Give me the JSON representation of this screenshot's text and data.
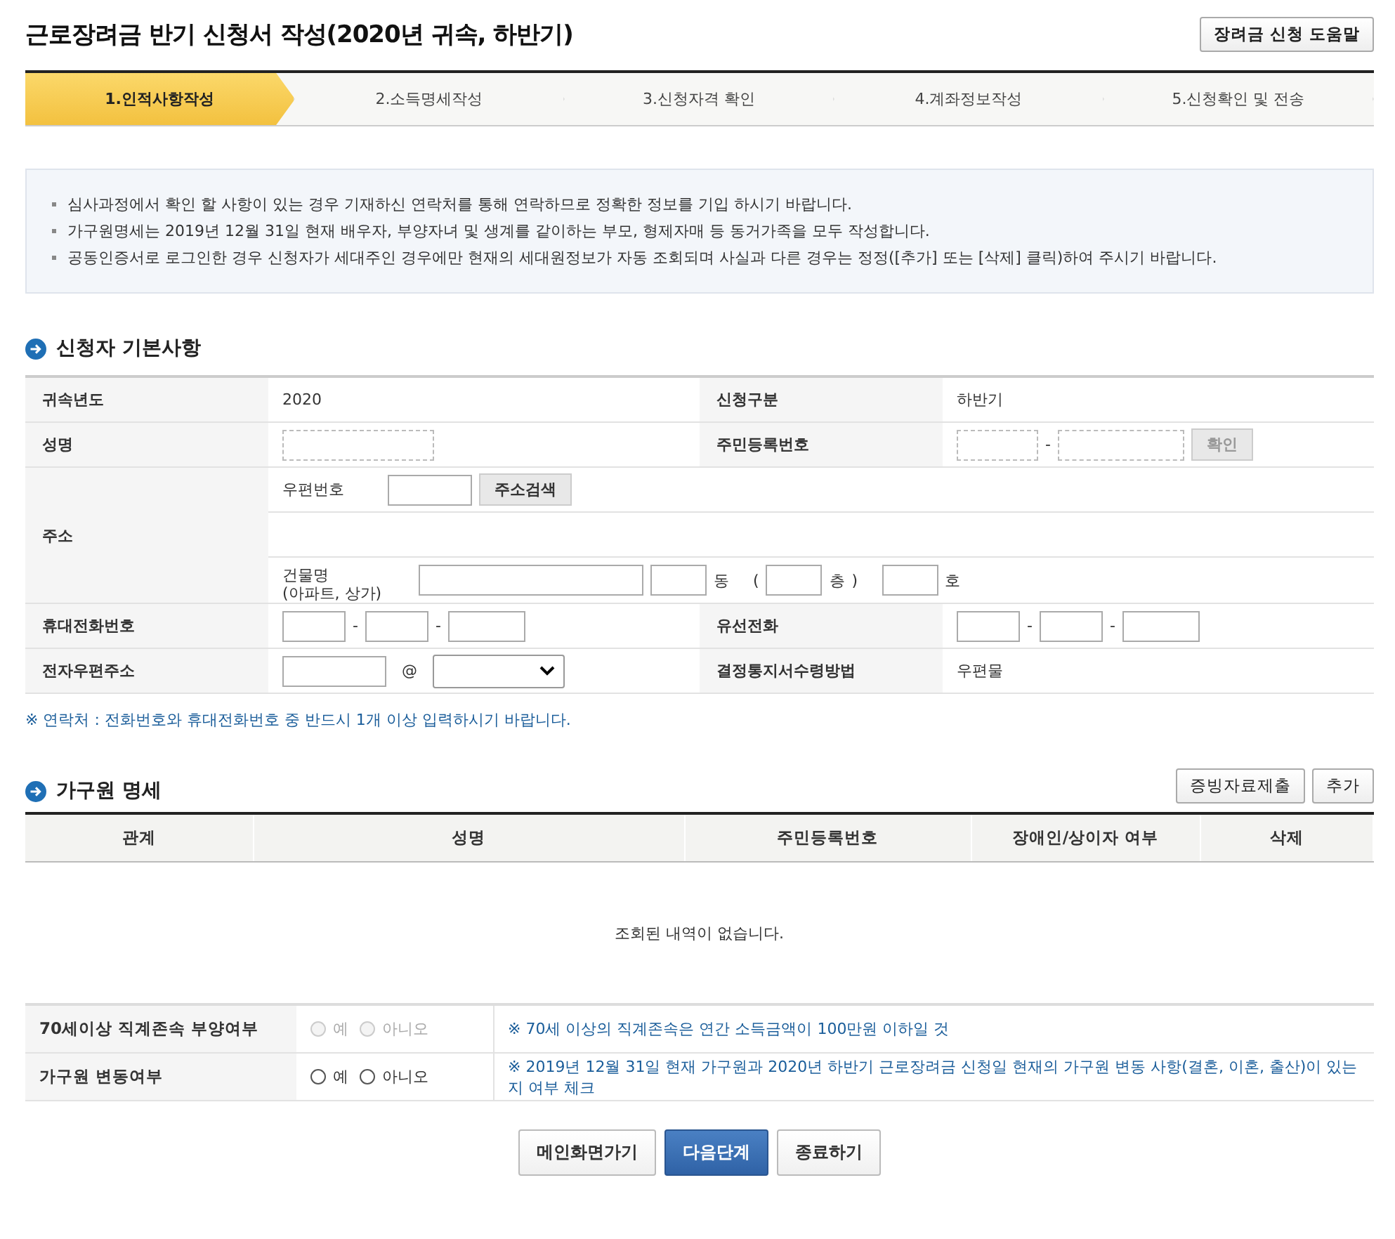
{
  "title": "근로장려금 반기 신청서 작성(2020년 귀속, 하반기)",
  "help_button": "장려금 신청 도움말",
  "steps": [
    {
      "label": "1.인적사항작성",
      "selected": true
    },
    {
      "label": "2.소득명세작성",
      "selected": false
    },
    {
      "label": "3.신청자격 확인",
      "selected": false
    },
    {
      "label": "4.계좌정보작성",
      "selected": false
    },
    {
      "label": "5.신청확인 및 전송",
      "selected": false
    }
  ],
  "notices": [
    "심사과정에서 확인 할 사항이 있는 경우 기재하신 연락처를 통해 연락하므로 정확한 정보를 기입 하시기 바랍니다.",
    "가구원명세는 2019년 12월 31일 현재 배우자, 부양자녀 및 생계를 같이하는 부모, 형제자매 등 동거가족을 모두 작성합니다.",
    "공동인증서로 로그인한 경우 신청자가 세대주인 경우에만 현재의 세대원정보가 자동 조회되며 사실과 다른 경우는 정정([추가] 또는 [삭제] 클릭)하여 주시기 바랍니다."
  ],
  "applicant": {
    "title": "신청자 기본사항",
    "year_label": "귀속년도",
    "year_value": "2020",
    "type_label": "신청구분",
    "type_value": "하반기",
    "name_label": "성명",
    "rrn_label": "주민등록번호",
    "rrn_separator": "-",
    "confirm_button": {
      "label": "확인",
      "disabled": true
    },
    "address_label": "주소",
    "postcode_label": "우편번호",
    "search_button": "주소검색",
    "building_label": "건물명",
    "building_sub": "(아파트, 상가)",
    "dong": "동",
    "floor_open": "(",
    "floor": "층",
    "floor_close": ")",
    "ho": "호",
    "mobile_label": "휴대전화번호",
    "mobile_separators": [
      "-",
      "-"
    ],
    "phone_label": "유선전화",
    "phone_separators": [
      "-",
      "-"
    ],
    "email_label": "전자우편주소",
    "at": "@",
    "method_label": "결정통지서수령방법",
    "method_value": "우편물"
  },
  "contact_note": "※ 연락처 : 전화번호와 휴대전화번호 중 반드시 1개 이상 입력하시기 바랍니다.",
  "family": {
    "title": "가구원 명세",
    "buttons": [
      "증빙자료제출",
      "추가"
    ],
    "columns": [
      "관계",
      "성명",
      "주민등록번호",
      "장애인/상이자 여부",
      "삭제"
    ],
    "empty_message": "조회된 내역이 없습니다."
  },
  "questions": [
    {
      "label": "70세이상 직계존속 부양여부",
      "disabled": true,
      "options": [
        {
          "label": "예",
          "selected": false
        },
        {
          "label": "아니오",
          "selected": false
        }
      ],
      "note": "※ 70세 이상의 직계존속은 연간 소득금액이 100만원 이하일 것"
    },
    {
      "label": "가구원 변동여부",
      "disabled": false,
      "options": [
        {
          "label": "예",
          "selected": false
        },
        {
          "label": "아니오",
          "selected": false
        }
      ],
      "note": "※ 2019년 12월 31일 현재 가구원과 2020년 하반기 근로장려금 신청일 현재의 가구원 변동 사항(결혼, 이혼, 출산)이 있는지 여부 체크"
    }
  ],
  "footer_buttons": [
    {
      "label": "메인화면가기",
      "kind": "normal"
    },
    {
      "label": "다음단계",
      "kind": "primary"
    },
    {
      "label": "종료하기",
      "kind": "normal"
    }
  ]
}
